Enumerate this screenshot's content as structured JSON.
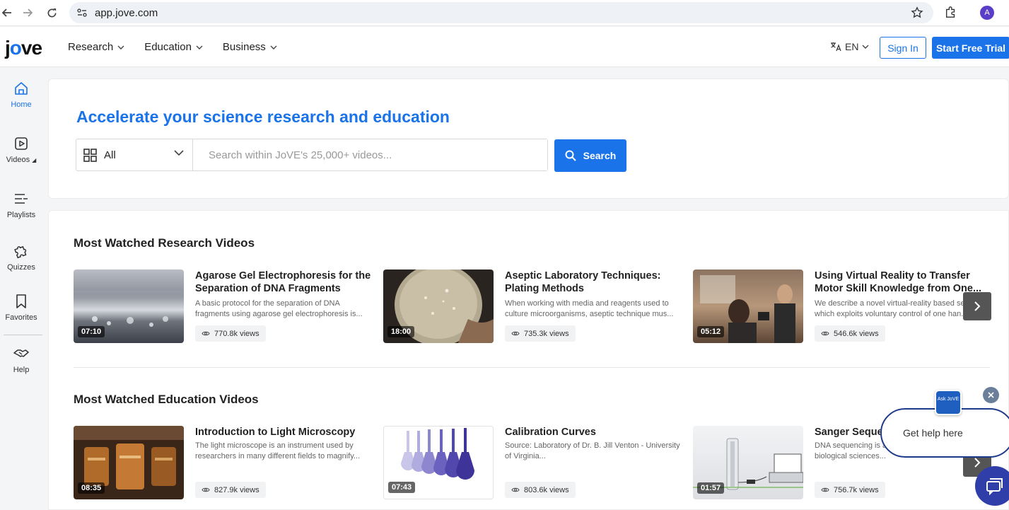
{
  "browser": {
    "url": "app.jove.com",
    "avatar_letter": "A"
  },
  "header": {
    "logo_pre": "j",
    "logo_o": "o",
    "logo_post": "ve",
    "nav": [
      {
        "label": "Research"
      },
      {
        "label": "Education"
      },
      {
        "label": "Business"
      }
    ],
    "language": "EN",
    "sign_in": "Sign In",
    "trial": "Start Free Trial"
  },
  "sidebar": {
    "items": [
      {
        "label": "Home",
        "icon": "home-icon"
      },
      {
        "label": "Videos",
        "icon": "play-icon"
      },
      {
        "label": "Playlists",
        "icon": "playlist-icon"
      },
      {
        "label": "Quizzes",
        "icon": "puzzle-icon"
      },
      {
        "label": "Favorites",
        "icon": "bookmark-icon"
      },
      {
        "label": "Help",
        "icon": "handshake-icon"
      }
    ]
  },
  "hero": {
    "title": "Accelerate your science research and education",
    "category": "All",
    "search_placeholder": "Search within JoVE's 25,000+ videos...",
    "search_button": "Search"
  },
  "research": {
    "title": "Most Watched Research Videos",
    "cards": [
      {
        "duration": "07:10",
        "title": "Agarose Gel Electrophoresis for the Separation of DNA Fragments",
        "desc": "A basic protocol for the separation of DNA fragments using agarose gel electrophoresis is...",
        "views": "770.8k views"
      },
      {
        "duration": "18:00",
        "title": "Aseptic Laboratory Techniques: Plating Methods",
        "desc": "When working with media and reagents used to culture microorganisms, aseptic technique mus...",
        "views": "735.3k views"
      },
      {
        "duration": "05:12",
        "title": "Using Virtual Reality to Transfer Motor Skill Knowledge from One...",
        "desc": "We describe a novel virtual-reality based se... which exploits voluntary control of one han...",
        "views": "546.6k views"
      }
    ]
  },
  "education": {
    "title": "Most Watched Education Videos",
    "cards": [
      {
        "duration": "08:35",
        "title": "Introduction to Light Microscopy",
        "desc": "The light microscope is an instrument used by researchers in many different fields to magnify...",
        "views": "827.9k views"
      },
      {
        "duration": "07:43",
        "title": "Calibration Curves",
        "desc": "Source: Laboratory of Dr. B. Jill Venton - University of Virginia...",
        "views": "803.6k views"
      },
      {
        "duration": "01:57",
        "title": "Sanger Seque...",
        "desc": "DNA sequencing is a... is routinely used in the biological sciences...",
        "views": "756.7k views"
      }
    ]
  },
  "help_widget": {
    "badge": "Ask JoVE",
    "text": "Get help here"
  }
}
